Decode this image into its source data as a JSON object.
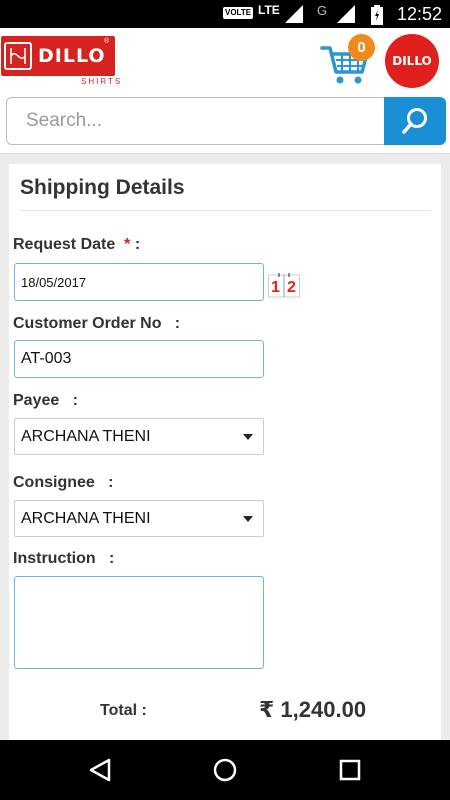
{
  "status_bar": {
    "volte": "VOLTE",
    "network": "LTE",
    "network2": "G",
    "time": "12:52"
  },
  "header": {
    "logo_text": "DILLO",
    "logo_sub": "SHIRTS",
    "cart_count": "0",
    "avatar_text": "DILLO",
    "accent": "#d7231f",
    "badge_color": "#f08a1c"
  },
  "search": {
    "placeholder": "Search...",
    "button_color": "#1a8fd6"
  },
  "shipping": {
    "title": "Shipping Details",
    "request_date_label": "Request Date",
    "required_mark": "*",
    "colon": ":",
    "request_date_value": "18/05/2017",
    "calendar_icon_text": "1|2",
    "customer_order_label": "Customer Order No   :",
    "customer_order_value": "AT-003",
    "payee_label": "Payee   :",
    "payee_value": "ARCHANA THENI",
    "consignee_label": "Consignee   :",
    "consignee_value": "ARCHANA THENI",
    "instruction_label": "Instruction   :",
    "instruction_value": ""
  },
  "total": {
    "label": "Total :",
    "value": "₹ 1,240.00"
  },
  "nav": {
    "back_icon": "back-triangle",
    "home_icon": "home-circle",
    "recents_icon": "recents-square"
  }
}
